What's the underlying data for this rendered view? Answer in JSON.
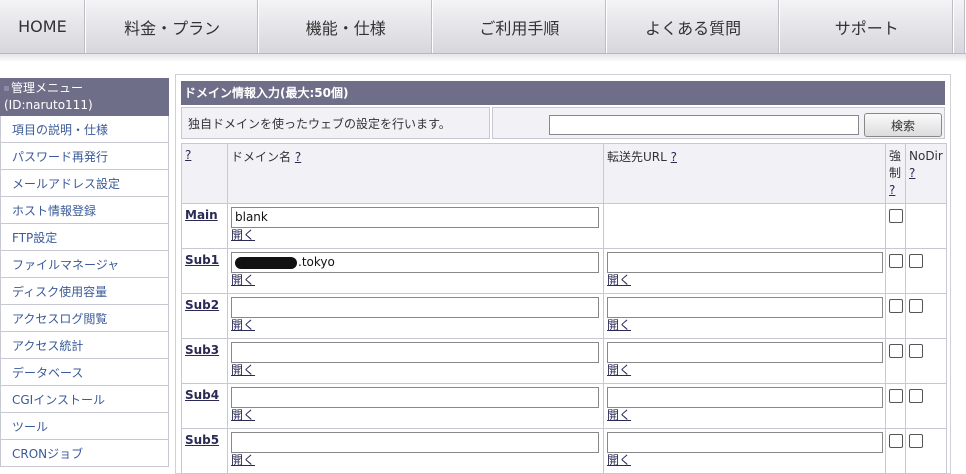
{
  "nav": {
    "items": [
      "HOME",
      "料金・プラン",
      "機能・仕様",
      "ご利用手順",
      "よくある質問",
      "サポート"
    ]
  },
  "sidebar": {
    "title": "管理メニュー",
    "user_id": "(ID:naruto111)",
    "items": [
      "項目の説明・仕様",
      "パスワード再発行",
      "メールアドレス設定",
      "ホスト情報登録",
      "FTP設定",
      "ファイルマネージャ",
      "ディスク使用容量",
      "アクセスログ閲覧",
      "アクセス統計",
      "データベース",
      "CGIインストール",
      "ツール",
      "CRONジョブ"
    ]
  },
  "panel": {
    "title": "ドメイン情報入力(最大:50個)",
    "intro": "独自ドメインを使ったウェブの設定を行います。",
    "search_button": "検索",
    "search_value": ""
  },
  "table": {
    "headers": {
      "help": "?",
      "domain": "ドメイン名",
      "forward": "転送先URL",
      "force_line1": "強",
      "force_line2": "制",
      "nodir": "NoDir",
      "help_mark": "?"
    },
    "open_label": "開く",
    "rows": [
      {
        "label": "Main",
        "domain": "blank",
        "forward": ""
      },
      {
        "label": "Sub1",
        "domain": ".tokyo",
        "forward": ""
      },
      {
        "label": "Sub2",
        "domain": "",
        "forward": ""
      },
      {
        "label": "Sub3",
        "domain": "",
        "forward": ""
      },
      {
        "label": "Sub4",
        "domain": "",
        "forward": ""
      },
      {
        "label": "Sub5",
        "domain": "",
        "forward": ""
      }
    ]
  },
  "colors": {
    "header_bg": "#6e6e88",
    "link": "#3a5a99",
    "cell_bg": "#f2f2f6"
  }
}
